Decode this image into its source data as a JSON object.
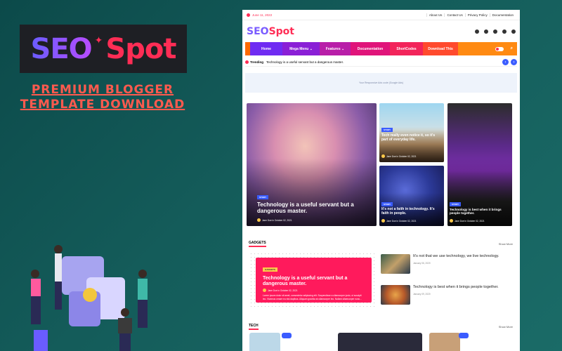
{
  "promo": {
    "logo_seo": "SEO",
    "logo_spot": "Spot",
    "title_line1": "PREMIUM BLOGGER",
    "title_line2": "TEMPLATE DOWNLOAD"
  },
  "site": {
    "topbar": {
      "date": "June 11, 2022",
      "links": [
        "About Us",
        "Contact Us",
        "Privacy Policy",
        "Documentation"
      ]
    },
    "logo": {
      "part1": "SEO",
      "part2": "Spot"
    },
    "nav": [
      "Home",
      "Mega Menu ⌄",
      "Features ⌄",
      "Documentation",
      "ShortCodes",
      "Download This"
    ],
    "trending": {
      "label": "Trending",
      "text": "Technology is a useful servant but a dangerous master."
    },
    "ad_text": "Your Responsive Ads code (Google Ads)",
    "featured": {
      "main": {
        "badge": "STORY",
        "title": "Technology is a useful servant but a dangerous master.",
        "meta": "Jane Doe in  October 02, 2021"
      },
      "top_right": {
        "badge": "STORY",
        "title": "Tech really even notice it, so it's part of everyday life.",
        "meta": "Jane Doe in  October 02, 2021"
      },
      "bottom_right": {
        "badge": "STORY",
        "title": "It's not a faith in technology. It's faith in people.",
        "meta": "Jane Doe in  October 02, 2021"
      },
      "far_right": {
        "badge": "STORY",
        "title": "Technology is best when it brings people together.",
        "meta": "Jane Doe in  October 02, 2021"
      }
    },
    "gadgets": {
      "heading": "GADGETS",
      "show_more": "Show More",
      "card": {
        "badge": "GADGETS",
        "title": "Technology is a useful servant but a dangerous master.",
        "meta": "Jane Doe  in  October 02, 2021",
        "desc": "Lorem ipsum dolor sit amet, consectetur adipiscing elit. Suspendisse a ullamcorper justo, ut suscipit leo. Vivamus ornare eu nisi dapibus. Aliquam gravida at ullamcorper leo. Nullam ullamcorper nunc..."
      },
      "list": [
        {
          "title": "It's not that we use technology, we live technology.",
          "date": "January 06, 2020"
        },
        {
          "title": "Technology is best when it brings people together.",
          "date": "January 09, 2020"
        }
      ]
    },
    "tech": {
      "heading": "TECH",
      "show_more": "Show More"
    }
  },
  "colors": {
    "accent": "#ff2d55",
    "brand_purple": "#7a5cff",
    "background": "#145c5a"
  },
  "icons": [
    "facebook-icon",
    "instagram-icon",
    "telegram-icon",
    "twitter-icon",
    "email-icon",
    "search-icon",
    "chevron-left-icon",
    "chevron-right-icon"
  ]
}
